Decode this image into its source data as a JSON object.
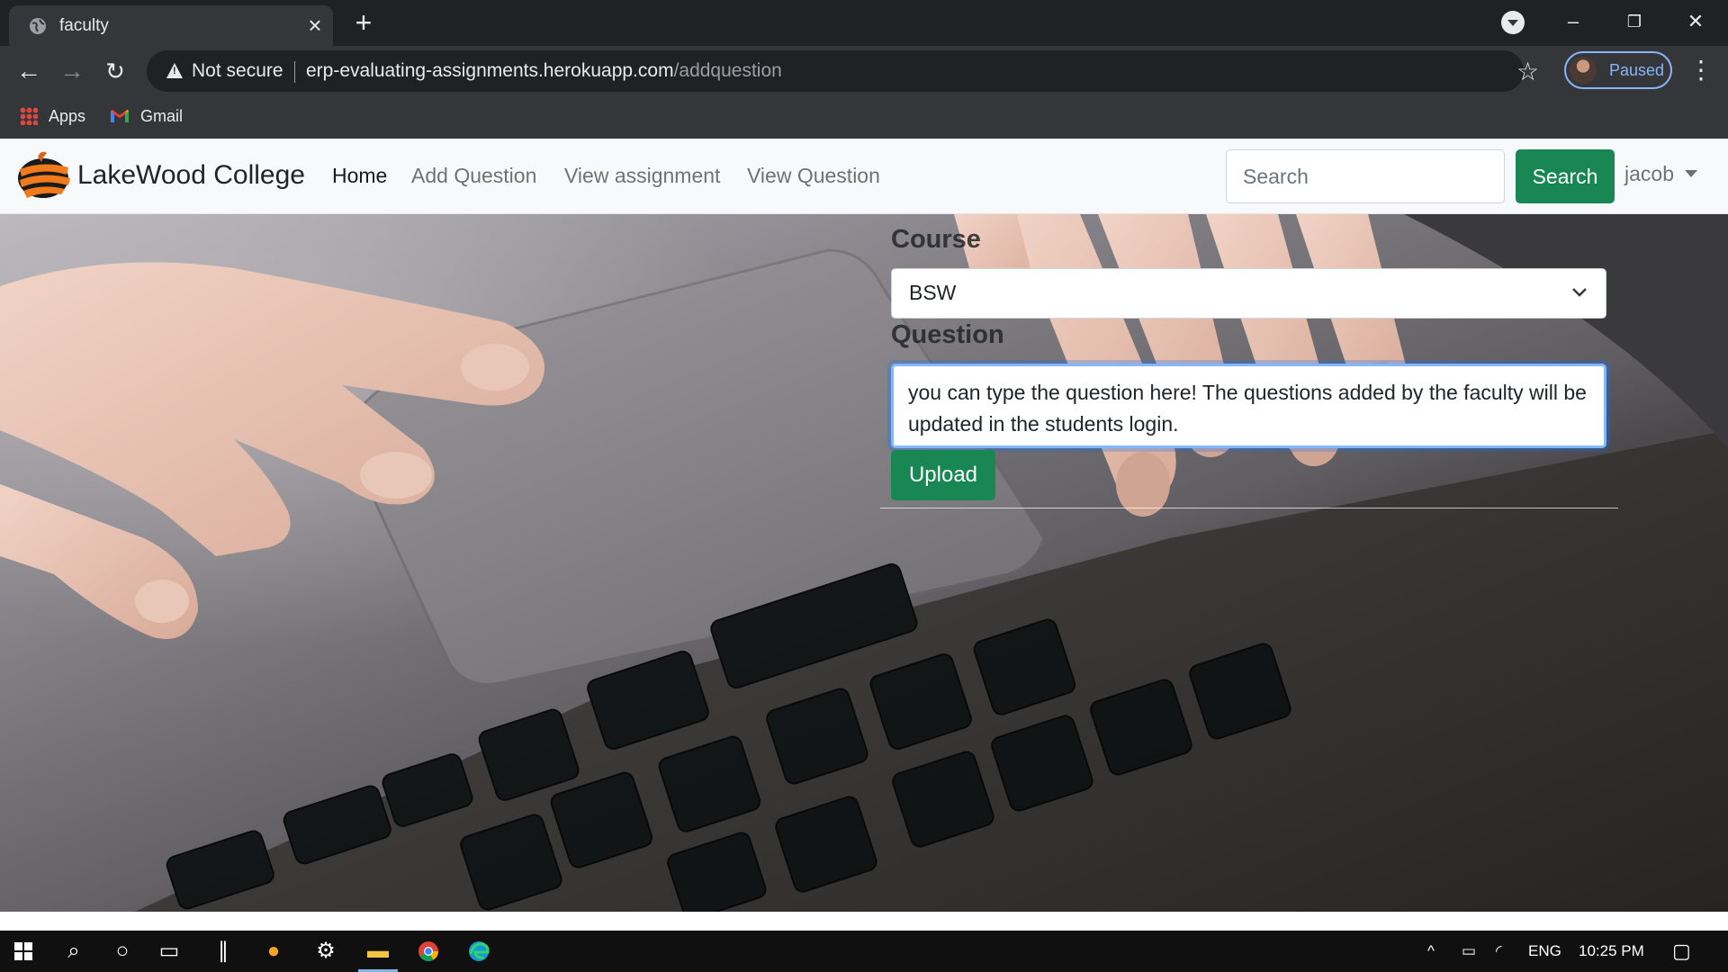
{
  "browser": {
    "tab_title": "faculty",
    "new_tab_symbol": "+",
    "address": {
      "security_label": "Not secure",
      "url_host": "erp-evaluating-assignments.herokuapp.com",
      "url_path": "/addquestion"
    },
    "profile_label": "Paused",
    "bookmarks": [
      {
        "label": "Apps",
        "icon": "apps-grid-icon"
      },
      {
        "label": "Gmail",
        "icon": "gmail-icon"
      }
    ]
  },
  "navbar": {
    "brand": "LakeWood College",
    "links": [
      {
        "label": "Home",
        "active": true
      },
      {
        "label": "Add Question",
        "active": false
      },
      {
        "label": "View assignment",
        "active": false
      },
      {
        "label": "View Question",
        "active": false
      }
    ],
    "search_placeholder": "Search",
    "search_button": "Search",
    "user": "jacob"
  },
  "form": {
    "course_label": "Course",
    "course_value": "BSW",
    "question_label": "Question",
    "question_text": "you can type the question here! The questions added by the faculty will be updated in the students login.",
    "upload_button": "Upload"
  },
  "taskbar": {
    "language": "ENG",
    "time": "10:25 PM"
  },
  "colors": {
    "primary_green": "#198754",
    "chrome_dark": "#202124",
    "chrome_toolbar": "#35363a",
    "focus_blue": "#86b7fe"
  }
}
